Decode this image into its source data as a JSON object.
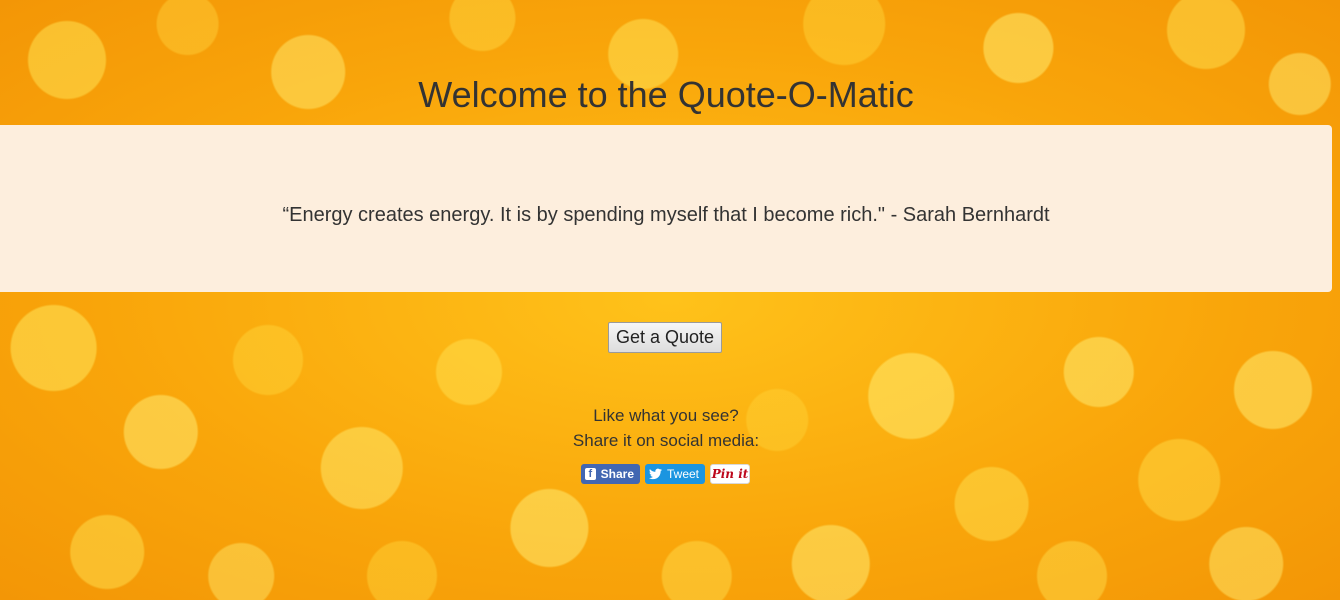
{
  "header": {
    "title": "Welcome to the Quote-O-Matic"
  },
  "quote": {
    "text": "“Energy creates energy. It is by spending myself that I become rich.\" - Sarah Bernhardt"
  },
  "actions": {
    "get_quote_label": "Get a Quote"
  },
  "share": {
    "line1": "Like what you see?",
    "line2": "Share it on social media:",
    "buttons": [
      {
        "label": "Share",
        "icon": "facebook-icon",
        "color": "#4267b2"
      },
      {
        "label": "Tweet",
        "icon": "twitter-icon",
        "color": "#1b95e0"
      },
      {
        "label": "Pin it",
        "icon": "pinterest-icon",
        "color": "#bd081c"
      }
    ]
  },
  "theme": {
    "background": "#f7a80c",
    "quote_box": "#fdeedd"
  }
}
